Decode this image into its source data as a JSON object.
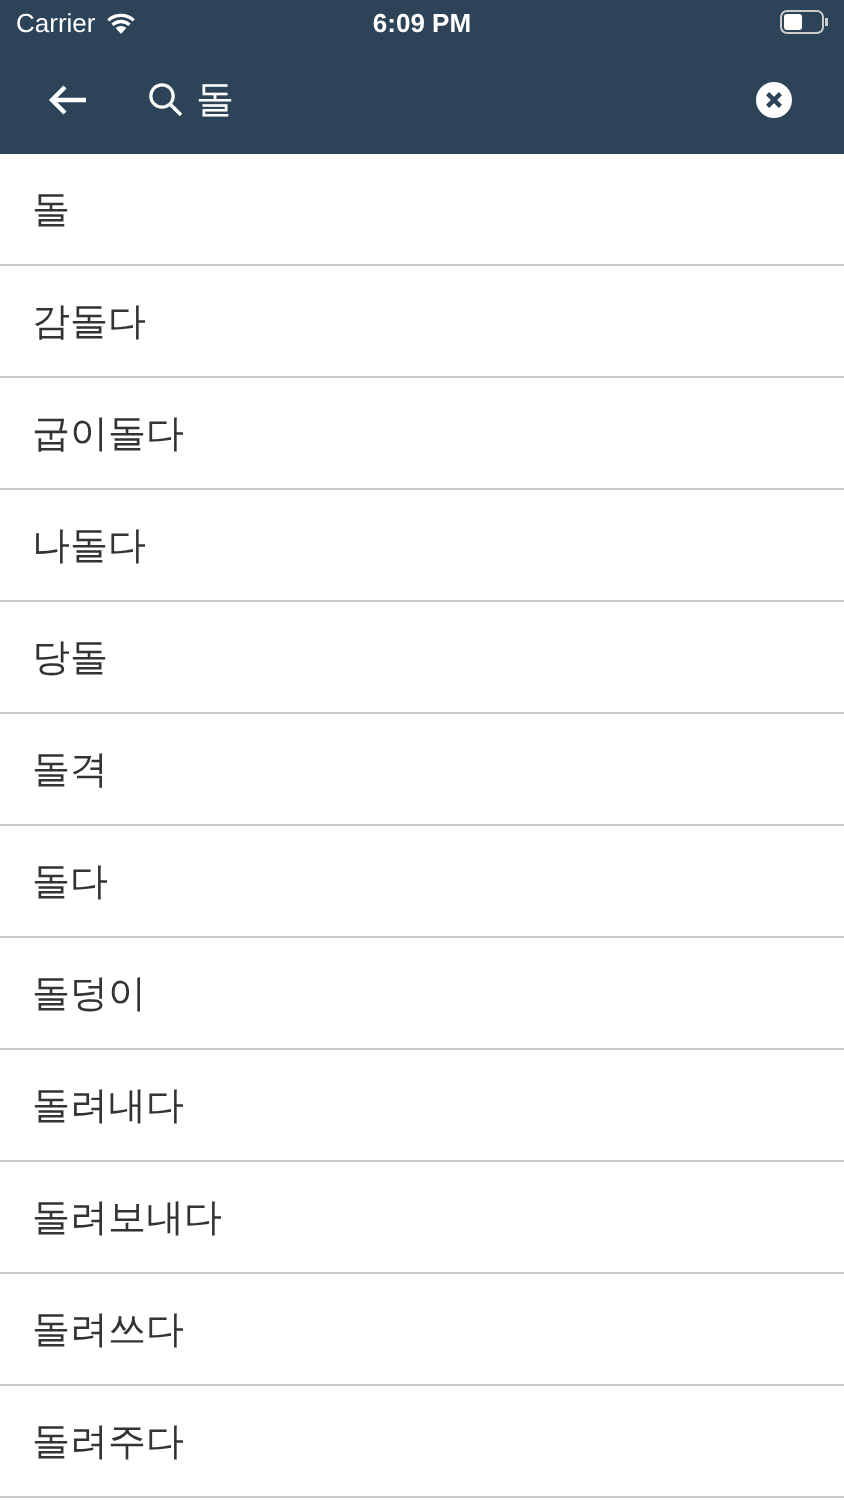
{
  "status_bar": {
    "carrier": "Carrier",
    "time": "6:09 PM"
  },
  "search": {
    "value": "돌"
  },
  "results": [
    "돌",
    "감돌다",
    "굽이돌다",
    "나돌다",
    "당돌",
    "돌격",
    "돌다",
    "돌덩이",
    "돌려내다",
    "돌려보내다",
    "돌려쓰다",
    "돌려주다"
  ]
}
